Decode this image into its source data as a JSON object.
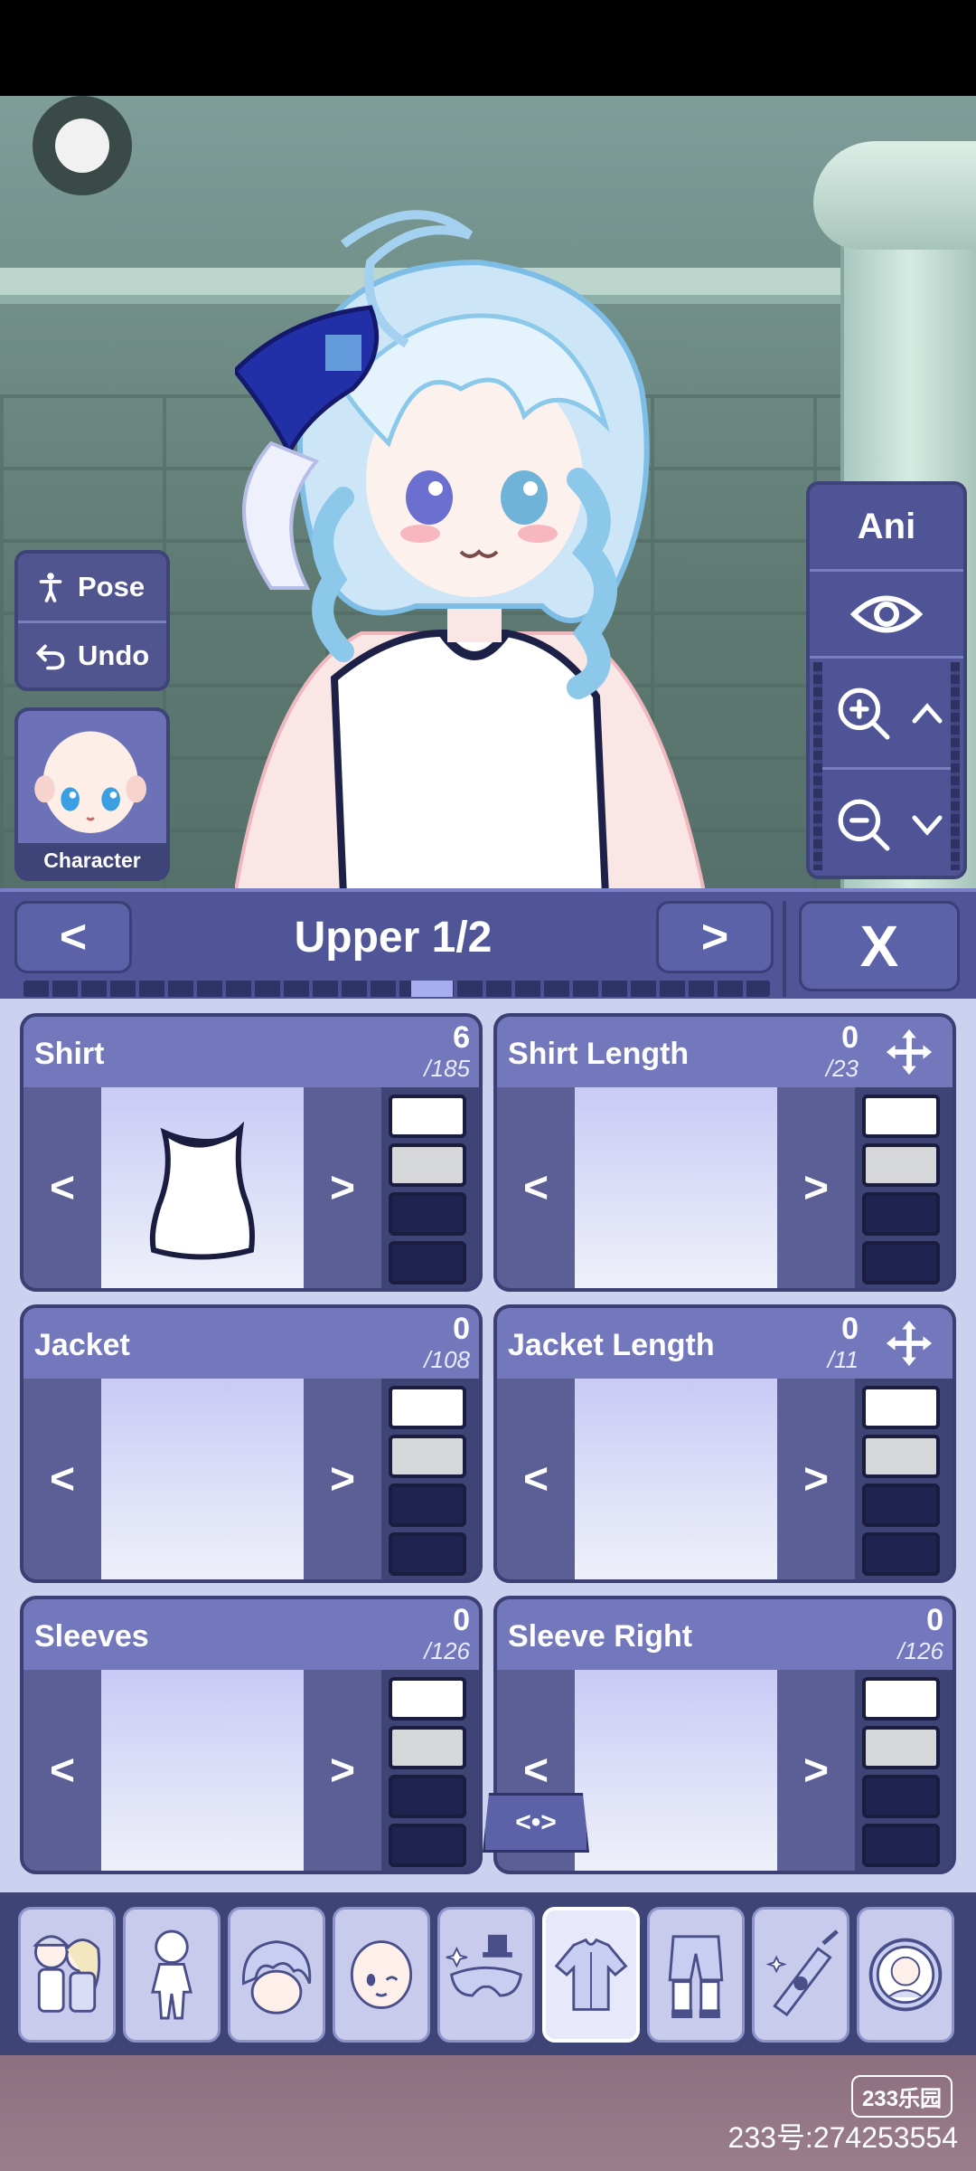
{
  "scene": {
    "pose_label": "Pose",
    "undo_label": "Undo",
    "character_label": "Character",
    "camera_label": "Ani"
  },
  "editor": {
    "title": "Upper 1/2",
    "prev_label": "<",
    "next_label": ">",
    "close_label": "X",
    "page_progress": 0.55,
    "center_toggle": "<•>",
    "swatch_colors": [
      "#ffffff",
      "#d6d7d9",
      "#1f2350",
      "#1f2350"
    ],
    "cards": [
      {
        "name": "Shirt",
        "count": "6",
        "total": "/185"
      },
      {
        "name": "Shirt Length",
        "count": "0",
        "total": "/23"
      },
      {
        "name": "Jacket",
        "count": "0",
        "total": "/108"
      },
      {
        "name": "Jacket Length",
        "count": "0",
        "total": "/11"
      },
      {
        "name": "Sleeves",
        "count": "0",
        "total": "/126"
      },
      {
        "name": "Sleeve Right",
        "count": "0",
        "total": "/126"
      }
    ],
    "arrow_left": "<",
    "arrow_right": ">"
  },
  "tabs": [
    {
      "icon": "group-icon"
    },
    {
      "icon": "body-icon"
    },
    {
      "icon": "hair-icon"
    },
    {
      "icon": "face-icon"
    },
    {
      "icon": "accessory-icon"
    },
    {
      "icon": "upper-clothes-icon",
      "active": true
    },
    {
      "icon": "lower-clothes-icon"
    },
    {
      "icon": "items-icon"
    },
    {
      "icon": "profile-icon"
    }
  ],
  "watermark": {
    "logo": "233乐园",
    "id": "233号:274253554"
  }
}
